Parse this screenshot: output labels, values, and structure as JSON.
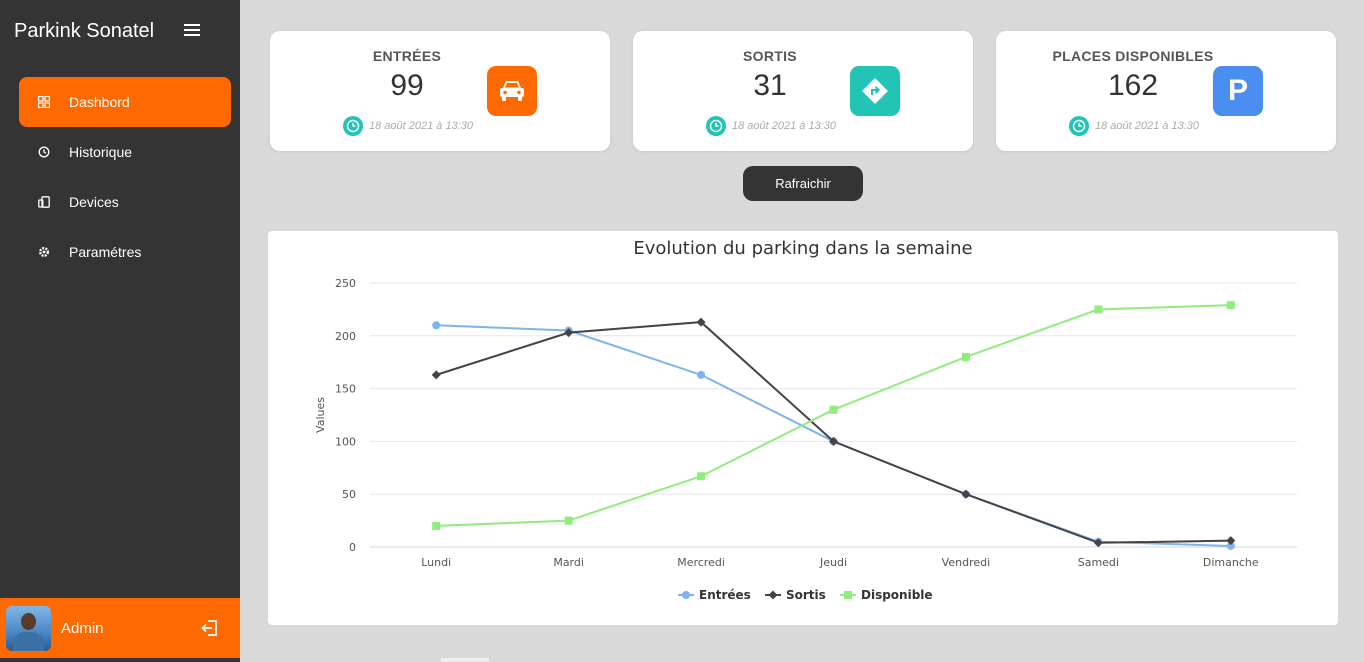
{
  "app": {
    "brand": "Parkink Sonatel"
  },
  "sidebar": {
    "items": [
      {
        "label": "Dashbord",
        "icon": "dashboard-icon",
        "active": true
      },
      {
        "label": "Historique",
        "icon": "history-icon",
        "active": false
      },
      {
        "label": "Devices",
        "icon": "devices-icon",
        "active": false
      },
      {
        "label": "Paramétres",
        "icon": "settings-icon",
        "active": false
      }
    ],
    "user": {
      "name": "Admin"
    }
  },
  "cards": [
    {
      "title": "ENTRÉES",
      "value": "99",
      "time": "18 août 2021 à 13:30",
      "icon": "car-icon",
      "color": "#ff6a00"
    },
    {
      "title": "SORTIS",
      "value": "31",
      "time": "18 août 2021 à 13:30",
      "icon": "directions-icon",
      "color": "#22c5b5"
    },
    {
      "title": "PLACES DISPONIBLES",
      "value": "162",
      "time": "18 août 2021 à 13:30",
      "icon": "parking-icon",
      "color": "#4a8ff0"
    }
  ],
  "refresh_label": "Rafraichir",
  "colors": {
    "accent": "#ff6a00",
    "sidebar": "#343434",
    "teal": "#22c5b5",
    "blue": "#4a8ff0"
  },
  "chart_data": {
    "type": "line",
    "title": "Evolution du parking dans la semaine",
    "ylabel": "Values",
    "xlabel": "",
    "ylim": [
      0,
      250
    ],
    "yticks": [
      0,
      50,
      100,
      150,
      200,
      250
    ],
    "categories": [
      "Lundi",
      "Mardi",
      "Mercredi",
      "Jeudi",
      "Vendredi",
      "Samedi",
      "Dimanche"
    ],
    "grid": true,
    "legend": "bottom-center",
    "series": [
      {
        "name": "Entrées",
        "color": "#7cb5ec",
        "marker": "circle",
        "values": [
          210,
          205,
          163,
          100,
          50,
          5,
          1
        ]
      },
      {
        "name": "Sortis",
        "color": "#434348",
        "marker": "diamond",
        "values": [
          163,
          203,
          213,
          100,
          50,
          4,
          6
        ]
      },
      {
        "name": "Disponible",
        "color": "#90ed7d",
        "marker": "square",
        "values": [
          20,
          25,
          67,
          130,
          180,
          225,
          229
        ]
      }
    ]
  }
}
